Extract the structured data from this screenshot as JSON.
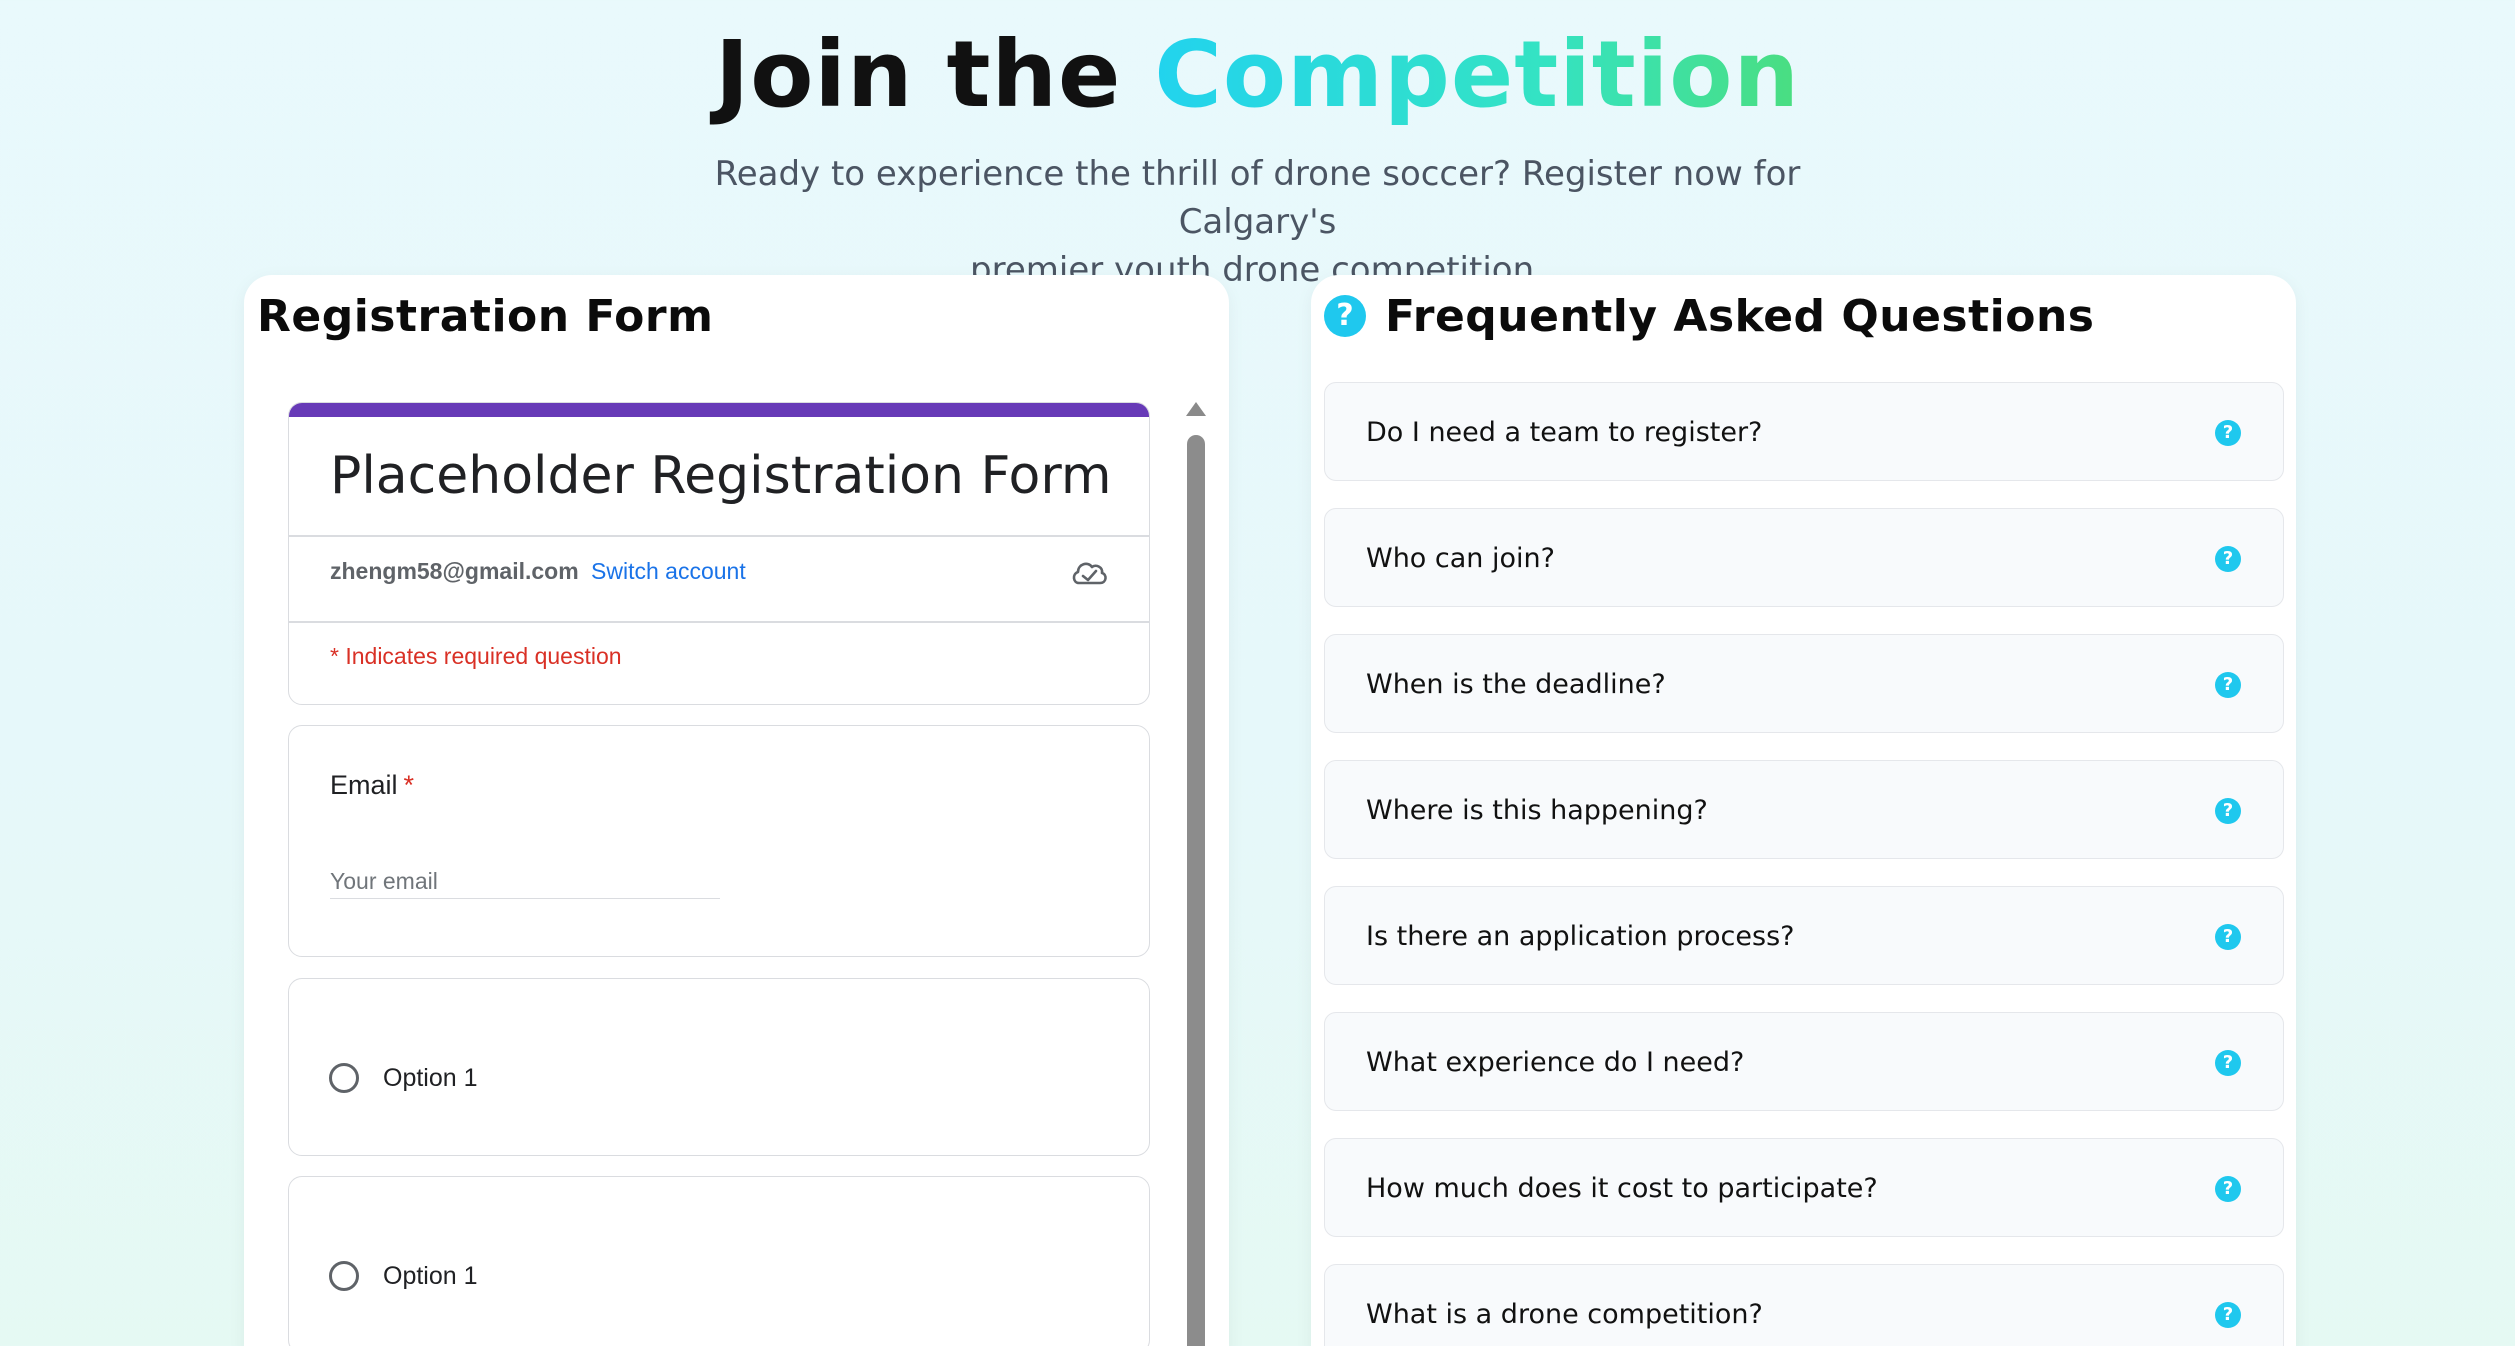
{
  "hero": {
    "title_plain": "Join the",
    "title_accent": "Competition",
    "subtitle_line1": "Ready to experience the thrill of drone soccer? Register now for Calgary's",
    "subtitle_line2": "premier youth drone competition."
  },
  "registration": {
    "heading": "Registration Form",
    "form_title": "Placeholder Registration Form",
    "account_email": "zhengm58@gmail.com",
    "switch_account": "Switch account",
    "required_note": "* Indicates required question",
    "email_label": "Email",
    "required_star": "*",
    "email_placeholder": "Your email",
    "option_1": "Option 1",
    "option_2": "Option 1",
    "accent_color": "#673ab7"
  },
  "faq": {
    "heading": "Frequently Asked Questions",
    "icon": "question-circle-icon",
    "icon_color": "#1fc8ee",
    "items": [
      {
        "q": "Do I need a team to register?"
      },
      {
        "q": "Who can join?"
      },
      {
        "q": "When is the deadline?"
      },
      {
        "q": "Where is this happening?"
      },
      {
        "q": "Is there an application process?"
      },
      {
        "q": "What experience do I need?"
      },
      {
        "q": "How much does it cost to participate?"
      },
      {
        "q": "What is a drone competition?"
      }
    ]
  }
}
